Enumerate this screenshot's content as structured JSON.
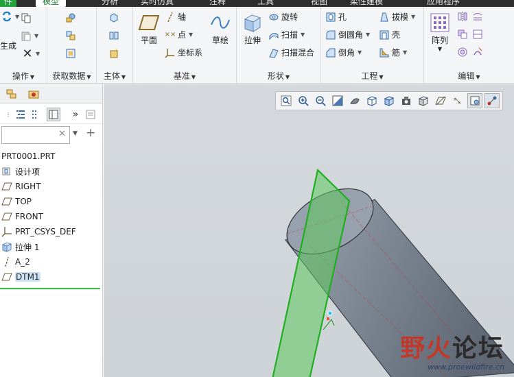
{
  "tabs": [
    {
      "label": "件"
    },
    {
      "label": "模型"
    },
    {
      "label": "分析"
    },
    {
      "label": "实时仿真"
    },
    {
      "label": "注释"
    },
    {
      "label": "工具"
    },
    {
      "label": "视图"
    },
    {
      "label": "柔性建模"
    },
    {
      "label": "应用程序"
    }
  ],
  "ribbon": {
    "operations": {
      "regenerate_label": "生成",
      "group_label": "操作"
    },
    "get_data": {
      "group_label": "获取数据"
    },
    "body": {
      "group_label": "主体"
    },
    "datum": {
      "plane_label": "平面",
      "axis_label": "轴",
      "point_label": "点",
      "csys_label": "坐标系",
      "sketch_label": "草绘",
      "group_label": "基准"
    },
    "shapes": {
      "extrude_label": "拉伸",
      "revolve_label": "旋转",
      "sweep_label": "扫描",
      "swept_blend_label": "扫描混合",
      "group_label": "形状"
    },
    "engineering": {
      "hole_label": "孔",
      "draft_label": "拔模",
      "round_label": "倒圆角",
      "shell_label": "壳",
      "chamfer_label": "倒角",
      "rib_label": "筋",
      "group_label": "工程"
    },
    "editing": {
      "pattern_label": "阵列",
      "group_label": "编辑"
    }
  },
  "model_tree": {
    "items": [
      {
        "label": "PRT0001.PRT",
        "icon": "part-icon"
      },
      {
        "label": "设计项",
        "icon": "design-items-icon"
      },
      {
        "label": "RIGHT",
        "icon": "datum-plane-icon"
      },
      {
        "label": "TOP",
        "icon": "datum-plane-icon"
      },
      {
        "label": "FRONT",
        "icon": "datum-plane-icon"
      },
      {
        "label": "PRT_CSYS_DEF",
        "icon": "csys-icon"
      },
      {
        "label": "拉伸 1",
        "icon": "extrude-icon"
      },
      {
        "label": "A_2",
        "icon": "datum-axis-icon"
      },
      {
        "label": "DTM1",
        "icon": "datum-plane-icon",
        "selected": true
      }
    ],
    "search_value": ""
  },
  "watermark": {
    "title_red": "野火",
    "title_dark": "论坛",
    "url": "www.proewildfire.cn"
  },
  "colors": {
    "accent_green": "#22a33b",
    "selection_blue": "#cfe3f7",
    "plane_green": "#3cba3c",
    "body_gray": "#7d8794",
    "watermark_red": "#c0392b"
  }
}
